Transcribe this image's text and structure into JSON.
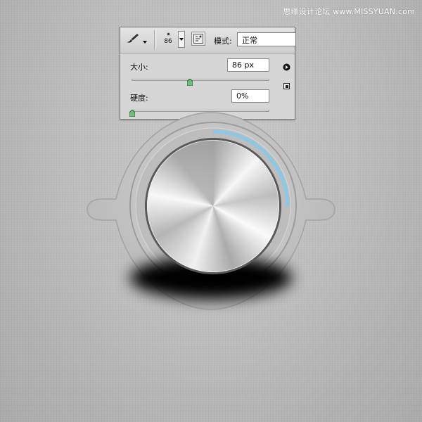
{
  "watermark": "思缘设计论坛 www.MISSYUAN.com",
  "brush_options": {
    "brush_size_preview": "86",
    "mode_label": "模式:",
    "mode_value": "正常",
    "size_label": "大小:",
    "size_value": "86 px",
    "size_level": 0.42,
    "hardness_label": "硬度:",
    "hardness_value": "0%",
    "hardness_level": 0.0
  },
  "knob": {
    "progress": 0.25,
    "progress_color": "#8cc8e6"
  },
  "colors": {
    "panel_bg": "#d6d6d6",
    "slider_thumb": "#6fbf7a"
  },
  "icons": [
    "brush-icon",
    "dropdown-arrow-icon",
    "brush-panel-toggle-icon",
    "flyout-menu-icon",
    "reset-icon"
  ]
}
